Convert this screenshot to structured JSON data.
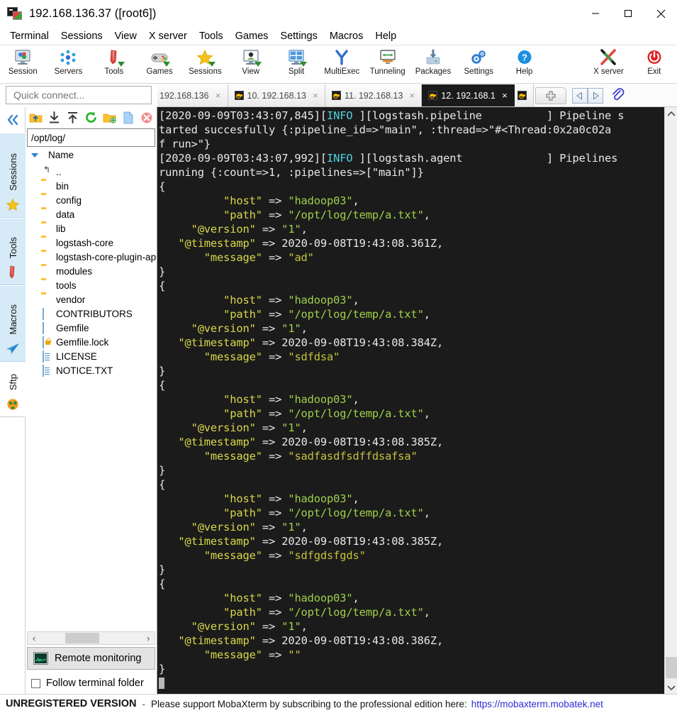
{
  "window": {
    "title": "192.168.136.37 ([root6])",
    "icon": "mobaxterm-icon",
    "controls": [
      {
        "name": "minimize-button",
        "glyph": "minimize-icon"
      },
      {
        "name": "maximize-button",
        "glyph": "maximize-icon"
      },
      {
        "name": "close-button",
        "glyph": "close-icon"
      }
    ]
  },
  "menubar": {
    "items": [
      {
        "label": "Terminal"
      },
      {
        "label": "Sessions"
      },
      {
        "label": "View"
      },
      {
        "label": "X server"
      },
      {
        "label": "Tools"
      },
      {
        "label": "Games"
      },
      {
        "label": "Settings"
      },
      {
        "label": "Macros"
      },
      {
        "label": "Help"
      }
    ]
  },
  "toolbar": {
    "items": [
      {
        "label": "Session",
        "icon": "session-icon"
      },
      {
        "label": "Servers",
        "icon": "servers-icon"
      },
      {
        "label": "Tools",
        "icon": "tools-icon"
      },
      {
        "label": "Games",
        "icon": "games-icon"
      },
      {
        "label": "Sessions",
        "icon": "sessions-star-icon"
      },
      {
        "label": "View",
        "icon": "view-icon"
      },
      {
        "label": "Split",
        "icon": "split-icon"
      },
      {
        "label": "MultiExec",
        "icon": "multiexec-icon"
      },
      {
        "label": "Tunneling",
        "icon": "tunneling-icon"
      },
      {
        "label": "Packages",
        "icon": "packages-icon"
      },
      {
        "label": "Settings",
        "icon": "settings-gear-icon"
      },
      {
        "label": "Help",
        "icon": "help-icon"
      }
    ],
    "right_items": [
      {
        "label": "X server",
        "icon": "x-server-icon"
      },
      {
        "label": "Exit",
        "icon": "exit-power-icon"
      }
    ]
  },
  "quick_connect": {
    "placeholder": "Quick connect...",
    "value": ""
  },
  "tabs": {
    "items": [
      {
        "label": "192.168.136",
        "active": false,
        "close": "×"
      },
      {
        "label": "10. 192.168.13",
        "active": false,
        "close": "×"
      },
      {
        "label": "11. 192.168.13",
        "active": false,
        "close": "×"
      },
      {
        "label": "12. 192.168.1",
        "active": true,
        "close": "×"
      },
      {
        "label": "",
        "active": false,
        "close": ""
      }
    ],
    "add_label": "+",
    "prev_label": "◁",
    "next_label": "▷",
    "clip_label": "clip-icon"
  },
  "ribbon": {
    "collapse_label": "«",
    "tabs": [
      {
        "label": "Sessions",
        "icon": "star-icon",
        "active": false
      },
      {
        "label": "Tools",
        "icon": "knife-icon",
        "active": false
      },
      {
        "label": "Macros",
        "icon": "paper-plane-icon",
        "active": false
      },
      {
        "label": "Sftp",
        "icon": "globe-icon",
        "active": true
      }
    ]
  },
  "sftp": {
    "toolbar": [
      {
        "name": "go-up-folder-button",
        "icon": "folder-up-icon"
      },
      {
        "name": "download-button",
        "icon": "download-icon"
      },
      {
        "name": "upload-button",
        "icon": "upload-icon"
      },
      {
        "name": "refresh-button",
        "icon": "refresh-icon"
      },
      {
        "name": "new-folder-button",
        "icon": "new-folder-icon"
      },
      {
        "name": "new-file-button",
        "icon": "new-file-icon"
      },
      {
        "name": "delete-button",
        "icon": "delete-icon"
      }
    ],
    "path": "/opt/log/",
    "path_ok_icon": "check-circle-icon",
    "column_header": "Name",
    "files": [
      {
        "name": "..",
        "type": "parent"
      },
      {
        "name": "bin",
        "type": "folder"
      },
      {
        "name": "config",
        "type": "folder"
      },
      {
        "name": "data",
        "type": "folder"
      },
      {
        "name": "lib",
        "type": "folder"
      },
      {
        "name": "logstash-core",
        "type": "folder"
      },
      {
        "name": "logstash-core-plugin-api",
        "type": "folder"
      },
      {
        "name": "modules",
        "type": "folder"
      },
      {
        "name": "tools",
        "type": "folder"
      },
      {
        "name": "vendor",
        "type": "folder"
      },
      {
        "name": "CONTRIBUTORS",
        "type": "file"
      },
      {
        "name": "Gemfile",
        "type": "file"
      },
      {
        "name": "Gemfile.lock",
        "type": "file-lock"
      },
      {
        "name": "LICENSE",
        "type": "file-text"
      },
      {
        "name": "NOTICE.TXT",
        "type": "file-text"
      }
    ],
    "hscroll": {
      "left": "‹",
      "right": "›"
    },
    "remote_monitoring_label": "Remote monitoring",
    "remote_monitoring_icon": "monitor-graph-icon",
    "follow_terminal_folder_label": "Follow terminal folder",
    "follow_terminal_folder_checked": false
  },
  "terminal": {
    "lines": [
      [
        {
          "t": "[2020-09-09T03:43:07,845][",
          "c": "white"
        },
        {
          "t": "INFO",
          "c": "cyan"
        },
        {
          "t": " ][logstash.pipeline          ] Pipeline s",
          "c": "white"
        }
      ],
      [
        {
          "t": "tarted succesfully {:pipeline_id=>\"main\", :thread=>\"#<Thread:0x2a0c02a",
          "c": "white"
        }
      ],
      [
        {
          "t": "f run>\"}",
          "c": "white"
        }
      ],
      [
        {
          "t": "[2020-09-09T03:43:07,992][",
          "c": "white"
        },
        {
          "t": "INFO",
          "c": "cyan"
        },
        {
          "t": " ][logstash.agent             ] Pipelines",
          "c": "white"
        }
      ],
      [
        {
          "t": "running {:count=>1, :pipelines=>[\"main\"]}",
          "c": "white"
        }
      ],
      [
        {
          "t": "{",
          "c": "white"
        }
      ],
      [
        {
          "t": "          \"host\"",
          "c": "yellow"
        },
        {
          "t": " => ",
          "c": "white"
        },
        {
          "t": "\"hadoop03\"",
          "c": "green"
        },
        {
          "t": ",",
          "c": "white"
        }
      ],
      [
        {
          "t": "          \"path\"",
          "c": "yellow"
        },
        {
          "t": " => ",
          "c": "white"
        },
        {
          "t": "\"/opt/log/temp/a.txt\"",
          "c": "green"
        },
        {
          "t": ",",
          "c": "white"
        }
      ],
      [
        {
          "t": "     \"@version\"",
          "c": "yellow"
        },
        {
          "t": " => ",
          "c": "white"
        },
        {
          "t": "\"1\"",
          "c": "green"
        },
        {
          "t": ",",
          "c": "white"
        }
      ],
      [
        {
          "t": "   \"@timestamp\"",
          "c": "yellow"
        },
        {
          "t": " => ",
          "c": "white"
        },
        {
          "t": "2020-09-08T19:43:08.361Z,",
          "c": "white"
        }
      ],
      [
        {
          "t": "       \"message\"",
          "c": "yellow"
        },
        {
          "t": " => ",
          "c": "white"
        },
        {
          "t": "\"ad\"",
          "c": "olive"
        }
      ],
      [
        {
          "t": "}",
          "c": "white"
        }
      ],
      [
        {
          "t": "{",
          "c": "white"
        }
      ],
      [
        {
          "t": "          \"host\"",
          "c": "yellow"
        },
        {
          "t": " => ",
          "c": "white"
        },
        {
          "t": "\"hadoop03\"",
          "c": "green"
        },
        {
          "t": ",",
          "c": "white"
        }
      ],
      [
        {
          "t": "          \"path\"",
          "c": "yellow"
        },
        {
          "t": " => ",
          "c": "white"
        },
        {
          "t": "\"/opt/log/temp/a.txt\"",
          "c": "green"
        },
        {
          "t": ",",
          "c": "white"
        }
      ],
      [
        {
          "t": "     \"@version\"",
          "c": "yellow"
        },
        {
          "t": " => ",
          "c": "white"
        },
        {
          "t": "\"1\"",
          "c": "green"
        },
        {
          "t": ",",
          "c": "white"
        }
      ],
      [
        {
          "t": "   \"@timestamp\"",
          "c": "yellow"
        },
        {
          "t": " => ",
          "c": "white"
        },
        {
          "t": "2020-09-08T19:43:08.384Z,",
          "c": "white"
        }
      ],
      [
        {
          "t": "       \"message\"",
          "c": "yellow"
        },
        {
          "t": " => ",
          "c": "white"
        },
        {
          "t": "\"sdfdsa\"",
          "c": "olive"
        }
      ],
      [
        {
          "t": "}",
          "c": "white"
        }
      ],
      [
        {
          "t": "{",
          "c": "white"
        }
      ],
      [
        {
          "t": "          \"host\"",
          "c": "yellow"
        },
        {
          "t": " => ",
          "c": "white"
        },
        {
          "t": "\"hadoop03\"",
          "c": "green"
        },
        {
          "t": ",",
          "c": "white"
        }
      ],
      [
        {
          "t": "          \"path\"",
          "c": "yellow"
        },
        {
          "t": " => ",
          "c": "white"
        },
        {
          "t": "\"/opt/log/temp/a.txt\"",
          "c": "green"
        },
        {
          "t": ",",
          "c": "white"
        }
      ],
      [
        {
          "t": "     \"@version\"",
          "c": "yellow"
        },
        {
          "t": " => ",
          "c": "white"
        },
        {
          "t": "\"1\"",
          "c": "green"
        },
        {
          "t": ",",
          "c": "white"
        }
      ],
      [
        {
          "t": "   \"@timestamp\"",
          "c": "yellow"
        },
        {
          "t": " => ",
          "c": "white"
        },
        {
          "t": "2020-09-08T19:43:08.385Z,",
          "c": "white"
        }
      ],
      [
        {
          "t": "       \"message\"",
          "c": "yellow"
        },
        {
          "t": " => ",
          "c": "white"
        },
        {
          "t": "\"sadfasdfsdffdsafsa\"",
          "c": "olive"
        }
      ],
      [
        {
          "t": "}",
          "c": "white"
        }
      ],
      [
        {
          "t": "{",
          "c": "white"
        }
      ],
      [
        {
          "t": "          \"host\"",
          "c": "yellow"
        },
        {
          "t": " => ",
          "c": "white"
        },
        {
          "t": "\"hadoop03\"",
          "c": "green"
        },
        {
          "t": ",",
          "c": "white"
        }
      ],
      [
        {
          "t": "          \"path\"",
          "c": "yellow"
        },
        {
          "t": " => ",
          "c": "white"
        },
        {
          "t": "\"/opt/log/temp/a.txt\"",
          "c": "green"
        },
        {
          "t": ",",
          "c": "white"
        }
      ],
      [
        {
          "t": "     \"@version\"",
          "c": "yellow"
        },
        {
          "t": " => ",
          "c": "white"
        },
        {
          "t": "\"1\"",
          "c": "green"
        },
        {
          "t": ",",
          "c": "white"
        }
      ],
      [
        {
          "t": "   \"@timestamp\"",
          "c": "yellow"
        },
        {
          "t": " => ",
          "c": "white"
        },
        {
          "t": "2020-09-08T19:43:08.385Z,",
          "c": "white"
        }
      ],
      [
        {
          "t": "       \"message\"",
          "c": "yellow"
        },
        {
          "t": " => ",
          "c": "white"
        },
        {
          "t": "\"sdfgdsfgds\"",
          "c": "olive"
        }
      ],
      [
        {
          "t": "}",
          "c": "white"
        }
      ],
      [
        {
          "t": "{",
          "c": "white"
        }
      ],
      [
        {
          "t": "          \"host\"",
          "c": "yellow"
        },
        {
          "t": " => ",
          "c": "white"
        },
        {
          "t": "\"hadoop03\"",
          "c": "green"
        },
        {
          "t": ",",
          "c": "white"
        }
      ],
      [
        {
          "t": "          \"path\"",
          "c": "yellow"
        },
        {
          "t": " => ",
          "c": "white"
        },
        {
          "t": "\"/opt/log/temp/a.txt\"",
          "c": "green"
        },
        {
          "t": ",",
          "c": "white"
        }
      ],
      [
        {
          "t": "     \"@version\"",
          "c": "yellow"
        },
        {
          "t": " => ",
          "c": "white"
        },
        {
          "t": "\"1\"",
          "c": "green"
        },
        {
          "t": ",",
          "c": "white"
        }
      ],
      [
        {
          "t": "   \"@timestamp\"",
          "c": "yellow"
        },
        {
          "t": " => ",
          "c": "white"
        },
        {
          "t": "2020-09-08T19:43:08.386Z,",
          "c": "white"
        }
      ],
      [
        {
          "t": "       \"message\"",
          "c": "yellow"
        },
        {
          "t": " => ",
          "c": "white"
        },
        {
          "t": "\"\"",
          "c": "olive"
        }
      ],
      [
        {
          "t": "}",
          "c": "white"
        }
      ],
      [
        {
          "t": "",
          "c": "white",
          "cursor": true
        }
      ]
    ]
  },
  "statusbar": {
    "unregistered": "UNREGISTERED VERSION",
    "dash": "-",
    "message": "Please support MobaXterm by subscribing to the professional edition here:",
    "link": "https://mobaxterm.mobatek.net"
  },
  "colors": {
    "terminal_bg": "#1b1b1b",
    "accent_blue": "#2a7fd4",
    "link_blue": "#2b2bd6",
    "folder_yellow": "#ffc02e",
    "info_cyan": "#4fd2e0",
    "key_yellow": "#d8d84a",
    "value_green": "#9fd14a"
  }
}
